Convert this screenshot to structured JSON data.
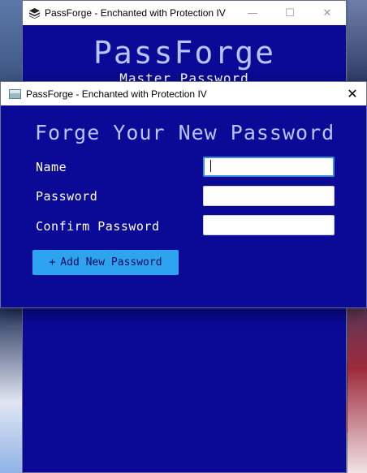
{
  "background_window": {
    "title": "PassForge - Enchanted with Protection IV",
    "heading": "PassForge",
    "subheading": "Master Password",
    "controls": {
      "minimize": "—",
      "maximize": "☐",
      "close": "✕"
    }
  },
  "dialog": {
    "title": "PassForge - Enchanted with Protection IV",
    "close": "✕",
    "heading": "Forge Your New Password",
    "fields": {
      "name": {
        "label": "Name",
        "value": ""
      },
      "password": {
        "label": "Password",
        "value": ""
      },
      "confirm": {
        "label": "Confirm Password",
        "value": ""
      }
    },
    "add_button": {
      "icon": "+",
      "label": "Add New Password"
    }
  },
  "colors": {
    "window_bg": "#0a0a96",
    "heading": "#b8c4ff",
    "button": "#2ea4f0"
  }
}
